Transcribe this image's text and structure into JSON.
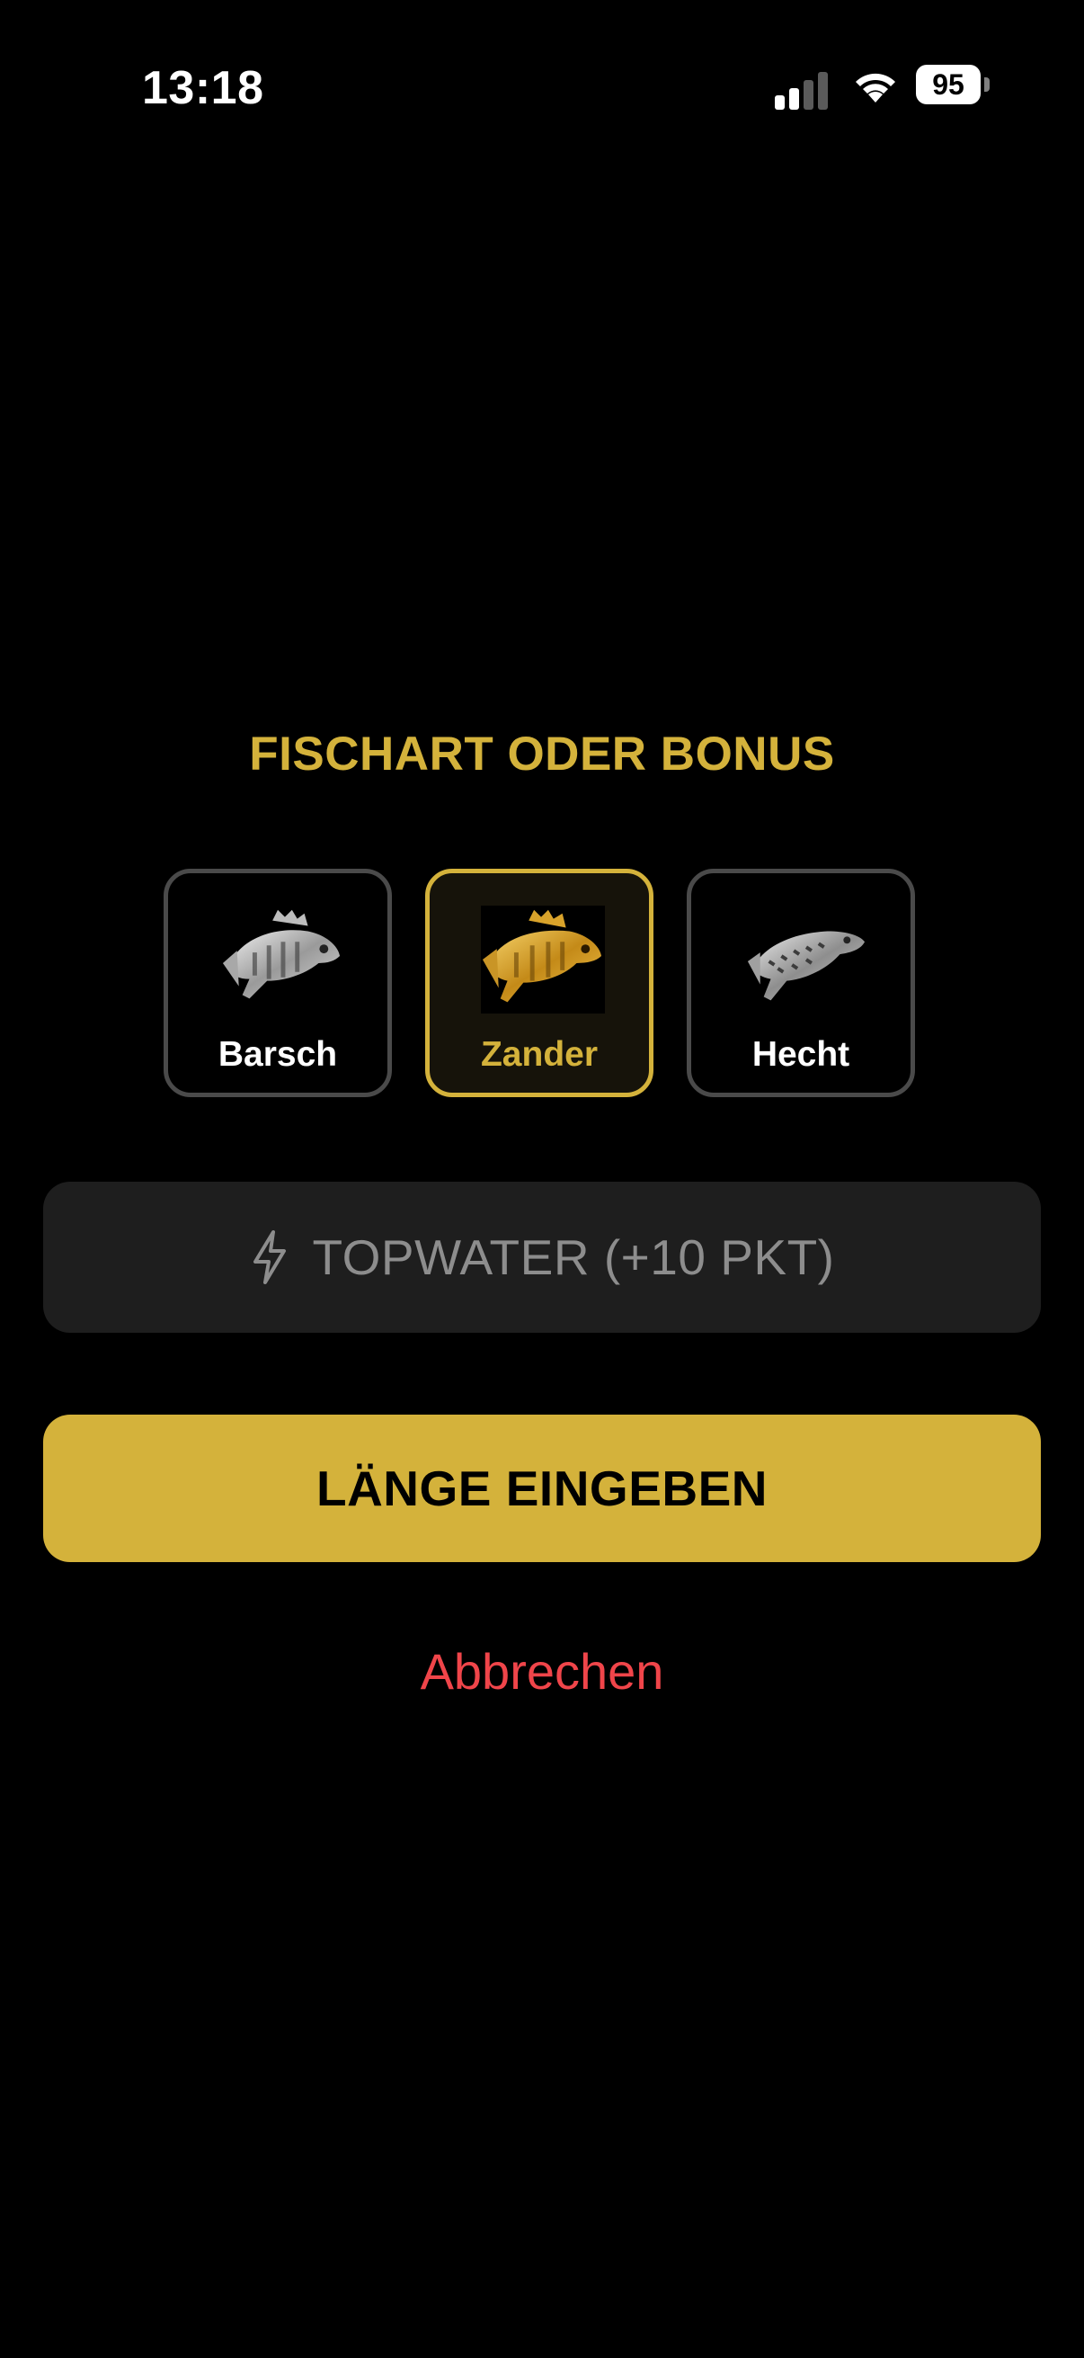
{
  "status_bar": {
    "time": "13:18",
    "battery": "95"
  },
  "title": "FISCHART ODER BONUS",
  "fish_options": [
    {
      "label": "Barsch",
      "icon": "perch-icon",
      "selected": false
    },
    {
      "label": "Zander",
      "icon": "zander-icon",
      "selected": true
    },
    {
      "label": "Hecht",
      "icon": "pike-icon",
      "selected": false
    }
  ],
  "bonus": {
    "label": "TOPWATER (+10 PKT)",
    "icon": "lightning-icon"
  },
  "primary_button": {
    "label": "LÄNGE EINGEBEN"
  },
  "cancel_button": {
    "label": "Abbrechen"
  },
  "colors": {
    "accent": "#d4b23b",
    "background": "#000000",
    "cancel": "#f0454a",
    "muted_text": "#8d8d8d"
  }
}
